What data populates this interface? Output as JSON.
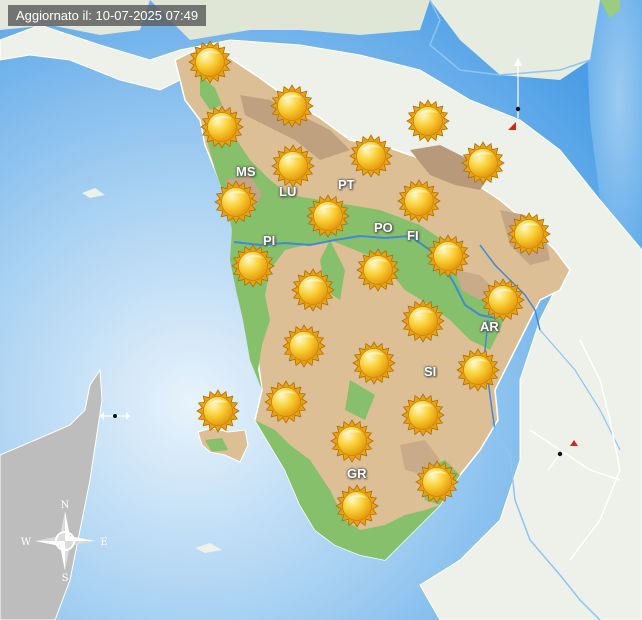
{
  "updated": "Aggiornato il: 10-07-2025 07:49",
  "compass": {
    "n": "N",
    "s": "S",
    "e": "E",
    "w": "W"
  },
  "provinces": [
    "MS",
    "LU",
    "PT",
    "PO",
    "FI",
    "PI",
    "AR",
    "SI",
    "GR"
  ],
  "weather_icon": "sunny-icon",
  "sunny_count": 28,
  "colors": {
    "sea": "#5aa8ea",
    "land_plain": "#86c06a",
    "land_hill": "#dcbf94",
    "river": "#3f8ad4",
    "outer_land": "#eef1ea"
  }
}
